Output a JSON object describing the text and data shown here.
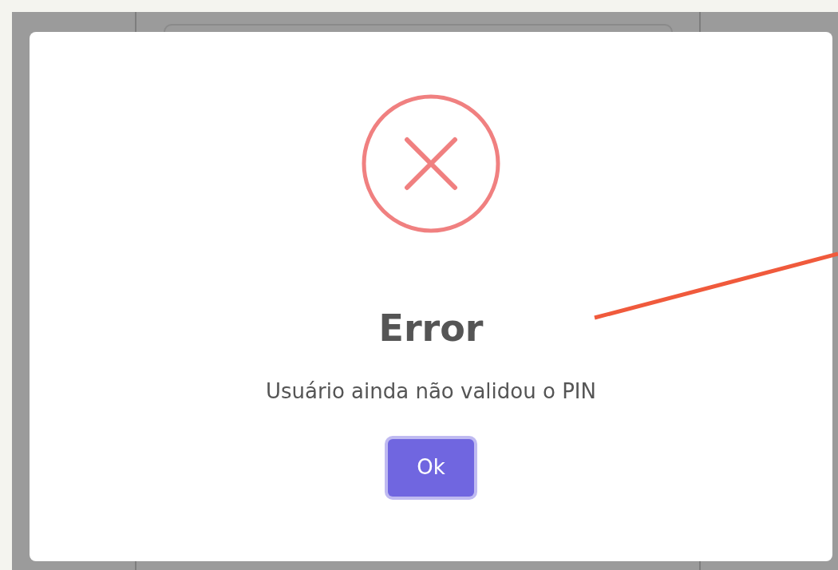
{
  "dialog": {
    "kind": "error",
    "title": "Error",
    "message": "Usuário ainda não validou o PIN",
    "button": "Ok"
  }
}
